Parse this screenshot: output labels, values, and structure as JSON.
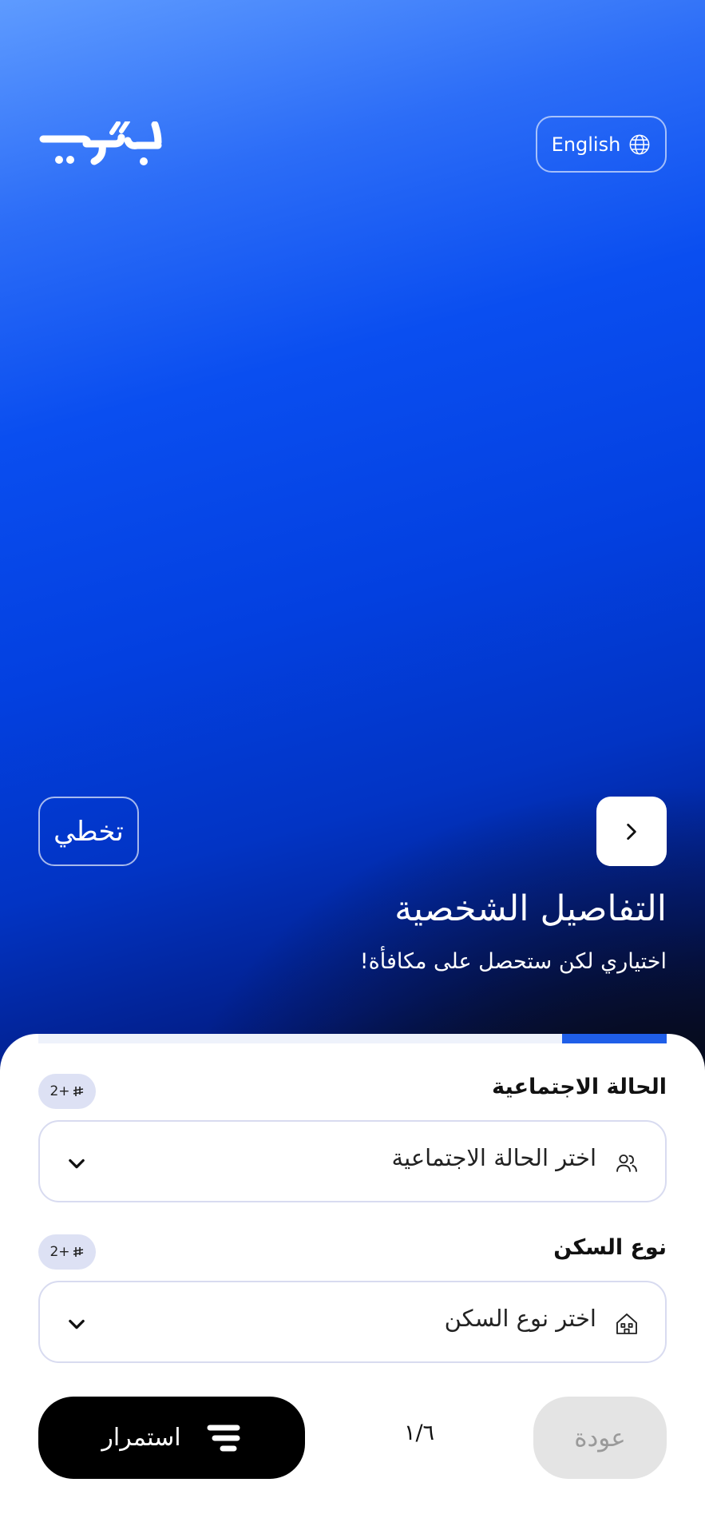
{
  "header": {
    "logo_text": "جوّاب",
    "language_button": "English"
  },
  "hero": {
    "skip_label": "تخطي",
    "title": "التفاصيل الشخصية",
    "subtitle": "اختياري لكن ستحصل على مكافأة!"
  },
  "progress": {
    "fraction": 0.167
  },
  "fields": [
    {
      "label": "الحالة الاجتماعية",
      "reward": "2+",
      "placeholder": "اختر الحالة الاجتماعية",
      "icon": "people-icon"
    },
    {
      "label": "نوع السكن",
      "reward": "2+",
      "placeholder": "اختر نوع السكن",
      "icon": "house-icon"
    }
  ],
  "footer": {
    "continue_label": "استمرار",
    "step_counter": "١/٦",
    "back_label": "عودة"
  },
  "colors": {
    "accent": "#1f5ee8",
    "hero_top": "#5e9bff",
    "hero_bottom": "#030a35",
    "border": "#d8dbf0",
    "badge_bg": "#dde1f4"
  }
}
